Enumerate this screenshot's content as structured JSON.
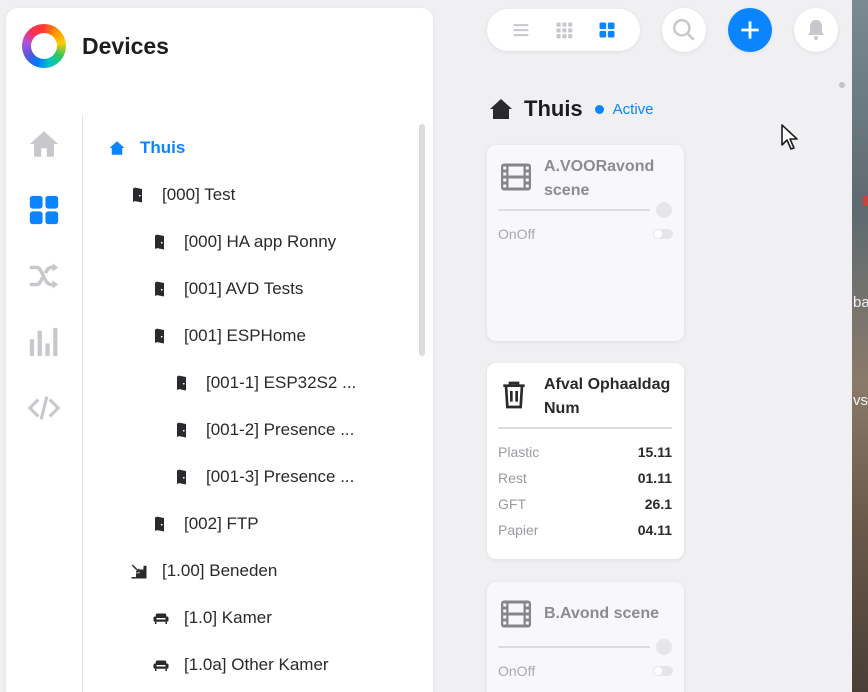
{
  "app": {
    "title": "Devices"
  },
  "rail": {
    "items": [
      {
        "name": "home",
        "icon": "home-icon",
        "active": false
      },
      {
        "name": "devices",
        "icon": "grid-icon",
        "active": true
      },
      {
        "name": "scenes",
        "icon": "shuffle-icon",
        "active": false
      },
      {
        "name": "stats",
        "icon": "bar-chart-icon",
        "active": false
      },
      {
        "name": "developer",
        "icon": "code-icon",
        "active": false
      }
    ]
  },
  "tree": {
    "items": [
      {
        "label": "Thuis",
        "icon": "home-icon",
        "depth": 0,
        "active": true
      },
      {
        "label": "[000] Test",
        "icon": "door-icon",
        "depth": 1
      },
      {
        "label": "[000] HA app Ronny",
        "icon": "door-icon",
        "depth": 2
      },
      {
        "label": "[001] AVD Tests",
        "icon": "door-icon",
        "depth": 2
      },
      {
        "label": "[001] ESPHome",
        "icon": "door-icon",
        "depth": 2
      },
      {
        "label": "[001-1] ESP32S2 ...",
        "icon": "door-icon",
        "depth": 3
      },
      {
        "label": "[001-2] Presence ...",
        "icon": "door-icon",
        "depth": 3
      },
      {
        "label": "[001-3] Presence ...",
        "icon": "door-icon",
        "depth": 3
      },
      {
        "label": "[002] FTP",
        "icon": "door-icon",
        "depth": 2
      },
      {
        "label": "[1.00] Beneden",
        "icon": "stairs-icon",
        "depth": 1
      },
      {
        "label": "[1.0] Kamer",
        "icon": "sofa-icon",
        "depth": 2
      },
      {
        "label": "[1.0a] Other Kamer",
        "icon": "sofa-icon",
        "depth": 2
      }
    ]
  },
  "toolbar": {
    "view_modes": [
      "list-view-icon",
      "small-grid-icon",
      "large-grid-icon"
    ],
    "active_view": "large-grid-icon",
    "search_icon": "search-icon",
    "add_icon": "plus-icon",
    "notifications_icon": "bell-icon"
  },
  "room": {
    "name": "Thuis",
    "status": "Active"
  },
  "cards": [
    {
      "title": "A.VOORavond scene",
      "icon": "film-icon",
      "dim": true,
      "property": "OnOff"
    },
    {
      "title": "Afval Ophaaldag Num",
      "icon": "trash-icon",
      "dim": false,
      "rows": [
        {
          "label": "Plastic",
          "value": "15.11"
        },
        {
          "label": "Rest",
          "value": "01.11"
        },
        {
          "label": "GFT",
          "value": "26.1"
        },
        {
          "label": "Papier",
          "value": "04.11"
        }
      ]
    },
    {
      "title": "B.Avond scene",
      "icon": "film-icon",
      "dim": true,
      "property": "OnOff"
    }
  ],
  "desktop": {
    "text1": "ba",
    "text2": "vs"
  },
  "colors": {
    "accent": "#0a84ff",
    "icon_gray": "#c7c7cc",
    "text": "#2a2a2e"
  }
}
